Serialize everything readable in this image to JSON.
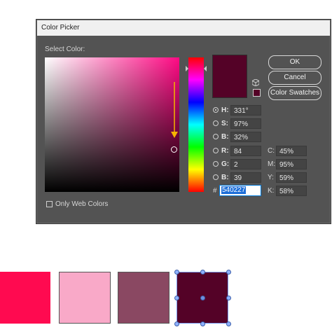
{
  "dialog": {
    "title": "Color Picker",
    "select_color_label": "Select Color:",
    "only_web_colors_label": "Only Web Colors",
    "only_web_colors_checked": false
  },
  "buttons": {
    "ok": "OK",
    "cancel": "Cancel",
    "swatches": "Color Swatches"
  },
  "hsb": [
    {
      "name": "H:",
      "value": "331°",
      "selected": true
    },
    {
      "name": "S:",
      "value": "97%",
      "selected": false
    },
    {
      "name": "B:",
      "value": "32%",
      "selected": false
    }
  ],
  "rgb": [
    {
      "name": "R:",
      "value": "84",
      "selected": false
    },
    {
      "name": "G:",
      "value": "2",
      "selected": false
    },
    {
      "name": "B:",
      "value": "39",
      "selected": false
    }
  ],
  "cmyk": [
    {
      "name": "C:",
      "value": "45%"
    },
    {
      "name": "M:",
      "value": "95%"
    },
    {
      "name": "Y:",
      "value": "59%"
    },
    {
      "name": "K:",
      "value": "58%"
    }
  ],
  "hex": {
    "label": "#",
    "value": "540227"
  },
  "colors": {
    "current": "#540227",
    "field_hue": "#ff0a84",
    "annotation_arrow": "#f5b400",
    "swatches": [
      "#ff0a50",
      "#f9a9c8",
      "#8a4862",
      "#540227"
    ]
  },
  "icons": {
    "cube": "3d-cube-icon",
    "arrow": "down-arrow-annotation"
  }
}
